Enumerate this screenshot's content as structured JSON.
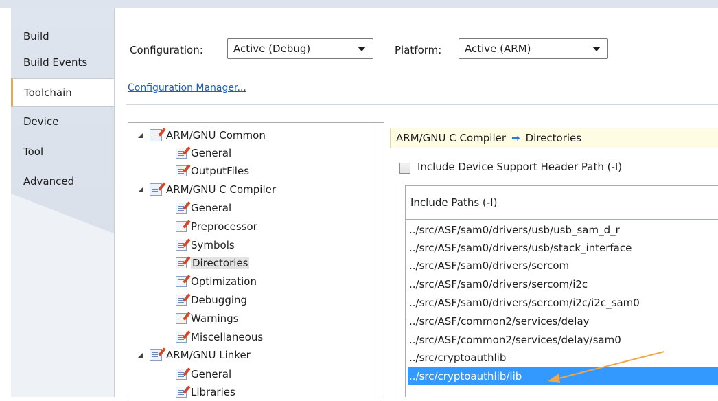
{
  "tabs": [
    "Build",
    "Build Events",
    "Toolchain",
    "Device",
    "Tool",
    "Advanced"
  ],
  "selected_tab": "Toolchain",
  "configuration": {
    "label": "Configuration:",
    "value": "Active (Debug)"
  },
  "platform": {
    "label": "Platform:",
    "value": "Active (ARM)"
  },
  "config_manager_link": "Configuration Manager...",
  "tree": {
    "groups": [
      {
        "label": "ARM/GNU Common",
        "items": [
          "General",
          "OutputFiles"
        ]
      },
      {
        "label": "ARM/GNU C Compiler",
        "items": [
          "General",
          "Preprocessor",
          "Symbols",
          "Directories",
          "Optimization",
          "Debugging",
          "Warnings",
          "Miscellaneous"
        ]
      },
      {
        "label": "ARM/GNU Linker",
        "items": [
          "General",
          "Libraries"
        ]
      }
    ],
    "selected_item": "Directories"
  },
  "breadcrumb": {
    "part1": "ARM/GNU C Compiler",
    "part2": "Directories"
  },
  "include_device_support": {
    "label": "Include Device Support Header Path (-I)",
    "checked": false
  },
  "include_paths": {
    "header": "Include Paths (-I)",
    "items": [
      "../src/ASF/sam0/drivers/usb/usb_sam_d_r",
      "../src/ASF/sam0/drivers/usb/stack_interface",
      "../src/ASF/sam0/drivers/sercom",
      "../src/ASF/sam0/drivers/sercom/i2c",
      "../src/ASF/sam0/drivers/sercom/i2c/i2c_sam0",
      "../src/ASF/common2/services/delay",
      "../src/ASF/common2/services/delay/sam0",
      "../src/cryptoauthlib",
      "../src/cryptoauthlib/lib"
    ],
    "selected_index": 8
  },
  "colors": {
    "selection": "#3399ff",
    "annotation_arrow": "#f0a64a",
    "link": "#1f5fb7"
  }
}
